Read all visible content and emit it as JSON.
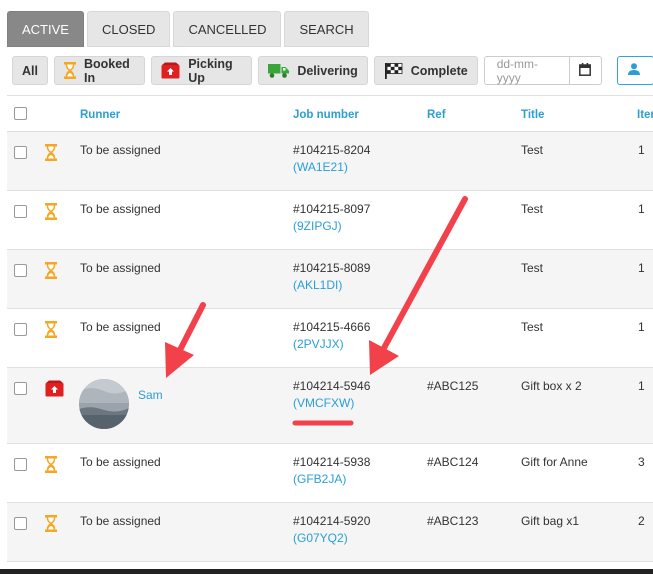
{
  "tabs": [
    {
      "label": "ACTIVE",
      "active": true
    },
    {
      "label": "CLOSED",
      "active": false
    },
    {
      "label": "CANCELLED",
      "active": false
    },
    {
      "label": "SEARCH",
      "active": false
    }
  ],
  "filters": {
    "all": "All",
    "booked_in": "Booked In",
    "picking_up": "Picking Up",
    "delivering": "Delivering",
    "complete": "Complete",
    "date_placeholder": "dd-mm-yyyy"
  },
  "columns": {
    "runner": "Runner",
    "job_number": "Job number",
    "ref": "Ref",
    "title": "Title",
    "items": "Iter"
  },
  "rows": [
    {
      "status": "booked-in",
      "runner": "To be assigned",
      "job": "#104215-8204",
      "code": "(WA1E21)",
      "ref": "",
      "title": "Test",
      "items": "1"
    },
    {
      "status": "booked-in",
      "runner": "To be assigned",
      "job": "#104215-8097",
      "code": "(9ZIPGJ)",
      "ref": "",
      "title": "Test",
      "items": "1"
    },
    {
      "status": "booked-in",
      "runner": "To be assigned",
      "job": "#104215-8089",
      "code": "(AKL1DI)",
      "ref": "",
      "title": "Test",
      "items": "1"
    },
    {
      "status": "booked-in",
      "runner": "To be assigned",
      "job": "#104215-4666",
      "code": "(2PVJJX)",
      "ref": "",
      "title": "Test",
      "items": "1"
    },
    {
      "status": "picking-up",
      "runner": "Sam",
      "job": "#104214-5946",
      "code": "(VMCFXW)",
      "ref": "#ABC125",
      "title": "Gift box x 2",
      "items": "1"
    },
    {
      "status": "booked-in",
      "runner": "To be assigned",
      "job": "#104214-5938",
      "code": "(GFB2JA)",
      "ref": "#ABC124",
      "title": "Gift for Anne",
      "items": "3"
    },
    {
      "status": "booked-in",
      "runner": "To be assigned",
      "job": "#104214-5920",
      "code": "(G07YQ2)",
      "ref": "#ABC123",
      "title": "Gift bag x1",
      "items": "2"
    }
  ],
  "colors": {
    "accent": "#2a9fd6",
    "hourglass": "#f5a623",
    "picking_up": "#e02020",
    "delivering": "#3aa63a",
    "annotation": "#f2414a"
  }
}
